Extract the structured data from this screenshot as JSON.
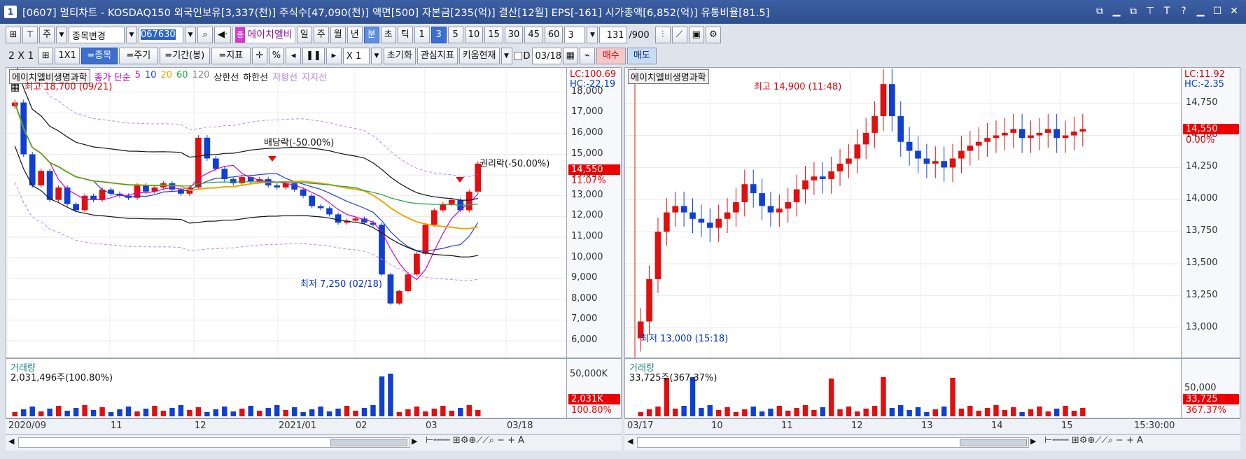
{
  "window": {
    "number": "1",
    "title": "[0607] 멀티차트 - KOSDAQ150 외국인보유[3,337(천)] 주식수[47,090(천)] 액면[500] 자본금[235(억)] 결산[12월] EPS[-161] 시가총액[6,852(억)] 유통비율[81.5]",
    "buttons": [
      "⧉",
      "▁",
      "⧉",
      "⊤",
      "T",
      "?",
      "▁",
      "☐",
      "✕"
    ]
  },
  "toolbar1": {
    "type_label": "주",
    "mode_label": "종목변경",
    "code_value": "067630",
    "stock_badge": "종",
    "stock_name": "에이치엘비",
    "periods": [
      "일",
      "주",
      "월",
      "년",
      "분",
      "초",
      "틱"
    ],
    "selected_period": "분",
    "intervals": [
      "1",
      "3",
      "5",
      "10",
      "15",
      "30",
      "45",
      "60"
    ],
    "selected_interval": "3",
    "interval_select": "3",
    "count_value": "131",
    "count_total": "/900"
  },
  "toolbar2": {
    "layout_a": "2 X 1",
    "layout_b": "1X1",
    "tab_stock": "=종목",
    "tab_period": "=주기",
    "tab_range": "=기간(봉)",
    "tab_indicator": "=지표",
    "pct_label": "%",
    "zoom_label": "X 1",
    "reset_label": "초기화",
    "watch_label": "관심지표",
    "kiwoom_label": "키움현재",
    "date_prefix": "D",
    "date_value": "03/18",
    "buy_label": "매수",
    "sell_label": "매도"
  },
  "left_chart": {
    "stock_name": "에이치엘비생명과학",
    "legend": [
      {
        "text": "종가 단순",
        "color": "#c000c0"
      },
      {
        "text": "5",
        "color": "#d000d0"
      },
      {
        "text": "10",
        "color": "#2040d0"
      },
      {
        "text": "20",
        "color": "#e8a800"
      },
      {
        "text": "60",
        "color": "#20a040"
      },
      {
        "text": "120",
        "color": "#888888"
      },
      {
        "text": "상한선",
        "color": "#111111"
      },
      {
        "text": "하한선",
        "color": "#111111"
      },
      {
        "text": "저항선",
        "color": "#c080f0"
      },
      {
        "text": "지지선",
        "color": "#c080f0"
      }
    ],
    "max_label": "최고 18,700 (09/21)",
    "min_label": "최저 7,250 (02/18)",
    "dividend_label": "배당락(-50.00%)",
    "rights_label": "권리락(-50.00%)",
    "lc": "LC:100.69",
    "hc": "HC:-22.19",
    "price_badge": "14,550",
    "pct_badge": "11.07%",
    "y_ticks": [
      "18,000",
      "17,000",
      "16,000",
      "15,000",
      "14,000",
      "13,000",
      "12,000",
      "11,000",
      "10,000",
      "9,000",
      "8,000",
      "7,000",
      "6,000"
    ],
    "x_ticks": [
      "2020/09",
      "11",
      "12",
      "2021/01",
      "02",
      "03",
      "03/18"
    ],
    "volume_title": "거래량",
    "volume_value": "2,031,496주(100.80%)",
    "volume_axis": "50,000K",
    "volume_badge": "2,031K",
    "volume_pct": "100.80%"
  },
  "right_chart": {
    "stock_name": "에이치엘비생명과학",
    "max_label": "최고 14,900 (11:48)",
    "min_label": "최저 13,000 (15:18)",
    "lc": "LC:11.92",
    "hc": "HC:-2.35",
    "price_badge": "14,550",
    "pct_badge": "0.00%",
    "y_ticks": [
      "14,750",
      "14,500",
      "14,250",
      "14,000",
      "13,750",
      "13,500",
      "13,250",
      "13,000"
    ],
    "x_ticks": [
      "03/17",
      "10",
      "11",
      "12",
      "13",
      "14",
      "15",
      "15:30:00"
    ],
    "volume_title": "거래량",
    "volume_value": "33,725주(367.37%)",
    "volume_axis": "50,000",
    "volume_badge": "33,725",
    "volume_pct": "367.37%"
  },
  "chart_data": [
    {
      "type": "candlestick",
      "title": "에이치엘비생명과학",
      "interval": "daily",
      "x_range": [
        "2020/09",
        "2021/03/18"
      ],
      "ylim": [
        6000,
        18700
      ],
      "close_approx": [
        17500,
        15000,
        13500,
        14200,
        12800,
        13400,
        12600,
        12300,
        13000,
        12800,
        13300,
        13100,
        13000,
        12900,
        13500,
        13200,
        13400,
        13600,
        13300,
        13100,
        13400,
        15800,
        14800,
        14300,
        13800,
        13600,
        13900,
        13700,
        13800,
        13500,
        13400,
        13600,
        13300,
        13000,
        12500,
        12400,
        12100,
        11700,
        11800,
        11900,
        11700,
        11600,
        9200,
        7800,
        8400,
        9200,
        10200,
        11600,
        12300,
        12600,
        12800,
        12300,
        13200,
        14550
      ],
      "last_price": 14550,
      "events": [
        "배당락(-50.00%)",
        "권리락(-50.00%)"
      ],
      "high": {
        "value": 18700,
        "date": "09/21"
      },
      "low": {
        "value": 7250,
        "date": "02/18"
      }
    },
    {
      "type": "candlestick",
      "title": "에이치엘비생명과학",
      "interval": "3-minute",
      "x_range": [
        "03/17",
        "15:30:00"
      ],
      "ylim": [
        12900,
        14950
      ],
      "close_approx": [
        13050,
        13380,
        13750,
        13900,
        13950,
        13900,
        13850,
        13820,
        13780,
        13850,
        13900,
        13980,
        14120,
        14050,
        13950,
        13900,
        13930,
        13980,
        14080,
        14150,
        14180,
        14160,
        14220,
        14280,
        14320,
        14430,
        14520,
        14650,
        14900,
        14650,
        14450,
        14380,
        14320,
        14280,
        14300,
        14250,
        14320,
        14380,
        14420,
        14450,
        14480,
        14500,
        14520,
        14550,
        14480,
        14500,
        14520,
        14550,
        14480,
        14500,
        14530,
        14550
      ],
      "last_price": 14550,
      "high": {
        "value": 14900,
        "time": "11:48"
      },
      "low": {
        "value": 13000,
        "time": "15:18"
      }
    }
  ]
}
